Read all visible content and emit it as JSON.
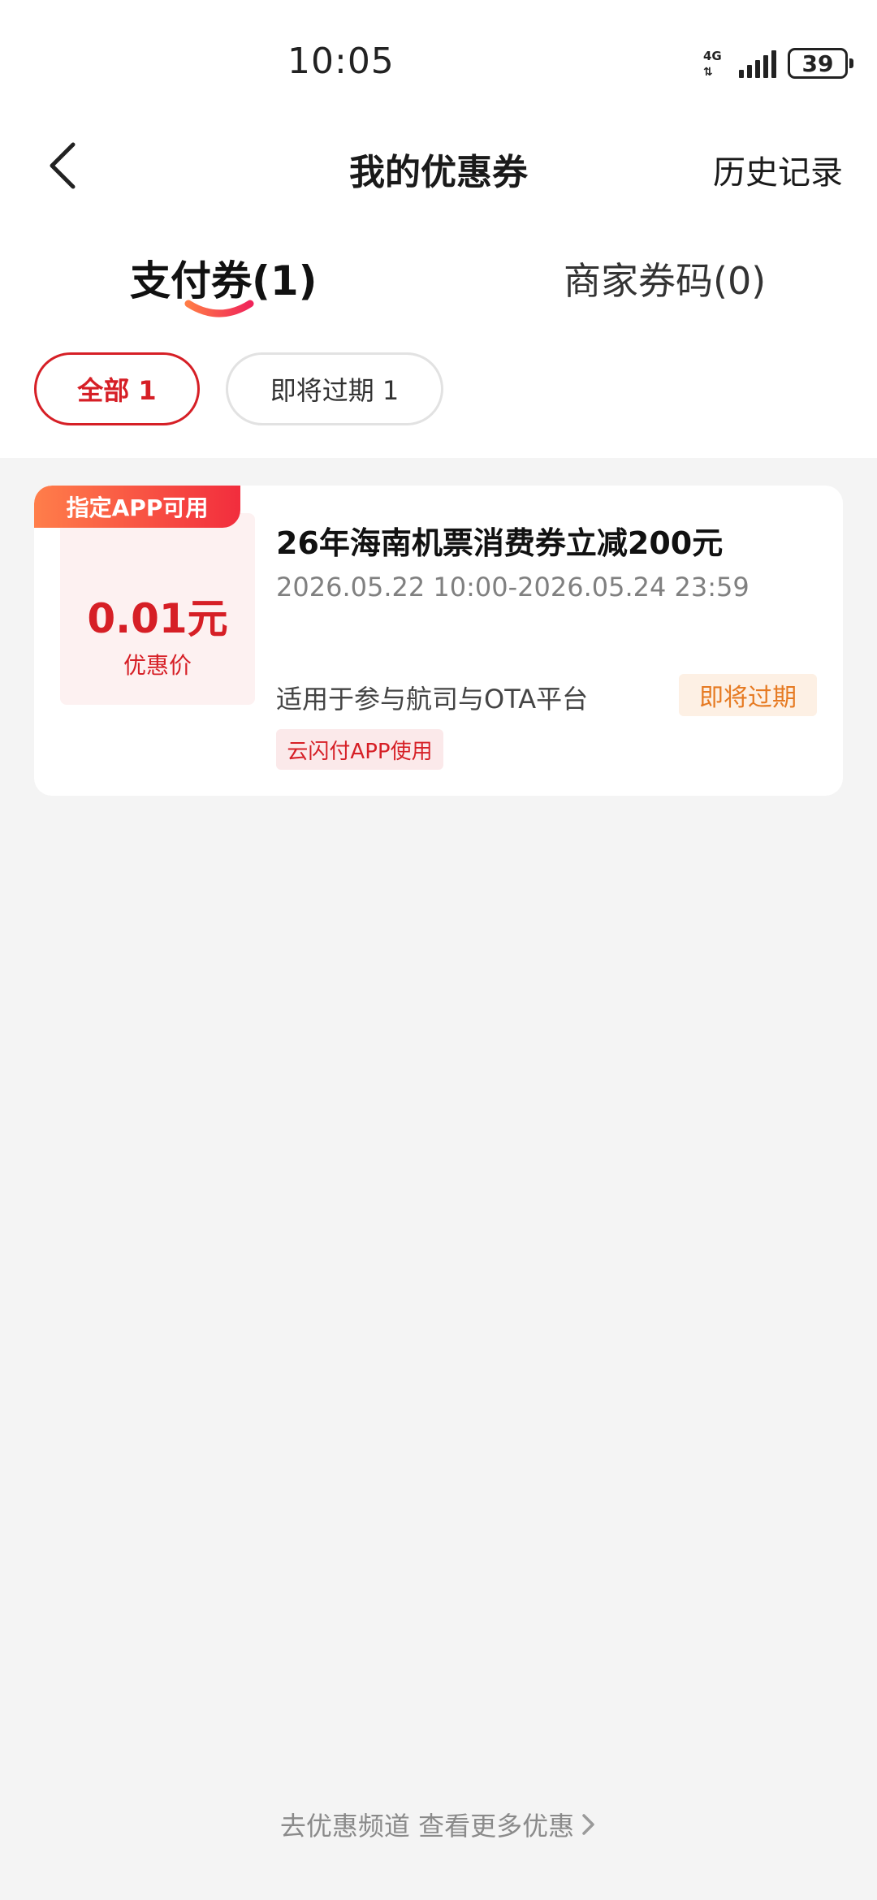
{
  "status_bar": {
    "time": "10:05",
    "network": "4G",
    "battery": "39"
  },
  "header": {
    "title": "我的优惠券",
    "history_label": "历史记录"
  },
  "tabs": [
    {
      "label": "支付券(1)",
      "active": true
    },
    {
      "label": "商家券码(0)",
      "active": false
    }
  ],
  "filters": [
    {
      "label": "全部 1",
      "selected": true
    },
    {
      "label": "即将过期 1",
      "selected": false
    }
  ],
  "coupons": [
    {
      "badge": "指定APP可用",
      "price": "0.01元",
      "price_label": "优惠价",
      "title": "26年海南机票消费券立减200元",
      "period": "2026.05.22 10:00-2026.05.24 23:59",
      "scope": "适用于参与航司与OTA平台",
      "status": "即将过期",
      "channel_tag": "云闪付APP使用"
    }
  ],
  "footer": {
    "link_label": "去优惠频道 查看更多优惠"
  },
  "colors": {
    "brand_red": "#d61f26",
    "warning_orange": "#e67a22",
    "page_bg": "#f4f4f4"
  }
}
